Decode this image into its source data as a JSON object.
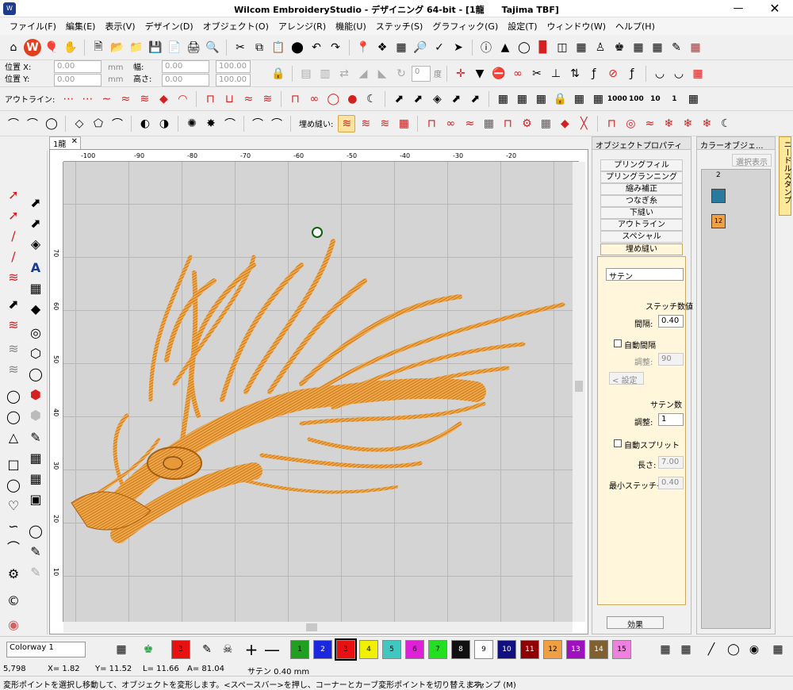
{
  "title": "Wilcom EmbroideryStudio - デザイニング 64-bit - [1龍　　Tajima TBF]",
  "menu": [
    "ファイル(F)",
    "編集(E)",
    "表示(V)",
    "デザイン(D)",
    "オブジェクト(O)",
    "アレンジ(R)",
    "機能(U)",
    "ステッチ(S)",
    "グラフィック(G)",
    "設定(T)",
    "ウィンドウ(W)",
    "ヘルプ(H)"
  ],
  "position": {
    "x_label": "位置 X:",
    "y_label": "位置 Y:",
    "x_val": "0.00",
    "y_val": "0.00",
    "unit": "mm"
  },
  "size": {
    "w_label": "幅:",
    "h_label": "高さ:",
    "w_val": "0.00",
    "h_val": "0.00",
    "w_pct": "100.00",
    "h_pct": "100.00",
    "unit": "mm",
    "pct": "%"
  },
  "rotate": {
    "value": "0",
    "unit": "度"
  },
  "outline_label": "アウトライン:",
  "fill_label": "埋め縫い:",
  "number_tools": [
    "1000",
    "100",
    "10",
    "1"
  ],
  "doc_tab": "1龍",
  "ruler_top": [
    "-100",
    "-90",
    "-80",
    "-70",
    "-60",
    "-50",
    "-40",
    "-30",
    "-20"
  ],
  "ruler_left": [
    "70",
    "60",
    "50",
    "40",
    "30",
    "20",
    "10"
  ],
  "props": {
    "title": "オブジェクトプロパティ",
    "tabs": [
      "プリングフィル",
      "プリングランニング",
      "縮み補正",
      "つなぎ糸",
      "下縫い",
      "アウトライン",
      "スペシャル",
      "埋め縫い"
    ],
    "stitch_type": "サテン",
    "stitch_value_label": "ステッチ数値",
    "spacing_label": "間隔:",
    "spacing_value": "0.40",
    "auto_spacing_label": "自動間隔",
    "adjust_label": "調整:",
    "adjust_value": "90",
    "set_label": "設定",
    "satin_count_label": "サテン数",
    "adjust2_label": "調整:",
    "adjust2_value": "1",
    "auto_split_label": "自動スプリット",
    "length_label": "長さ:",
    "length_value": "7.00",
    "min_stitch_label": "最小ステッチ長:",
    "min_stitch_value": "0.40",
    "effect_button": "効果"
  },
  "color_panel": {
    "title": "カラーオブジェ...",
    "select_button": "選択表示",
    "item_label": "2",
    "item2_label": "12"
  },
  "side_tab": "ニードルスタンプ",
  "colorway": "Colorway 1",
  "palette": [
    {
      "n": "3",
      "c": "#e81010"
    },
    {
      "n": "1",
      "c": "#20a020"
    },
    {
      "n": "2",
      "c": "#1c28e0"
    },
    {
      "n": "3",
      "c": "#e81010"
    },
    {
      "n": "4",
      "c": "#f0f000"
    },
    {
      "n": "5",
      "c": "#40c8c0"
    },
    {
      "n": "6",
      "c": "#e020d8"
    },
    {
      "n": "7",
      "c": "#20e020"
    },
    {
      "n": "8",
      "c": "#101010"
    },
    {
      "n": "9",
      "c": "#ffffff"
    },
    {
      "n": "10",
      "c": "#101080"
    },
    {
      "n": "11",
      "c": "#900000"
    },
    {
      "n": "12",
      "c": "#f0a040"
    },
    {
      "n": "13",
      "c": "#a010c0"
    },
    {
      "n": "14",
      "c": "#806030"
    },
    {
      "n": "15",
      "c": "#f080e0"
    }
  ],
  "coords": {
    "count": "5,798",
    "x": "X=   1.82",
    "y": "Y=   11.52",
    "l": "L=   11.66",
    "a": "A=   81.04",
    "stitch": "サテン  0.40 mm"
  },
  "status": {
    "left": "変形ポイントを選択し移動して、オブジェクトを変形します。<スペースバー>を押し、コーナーとカーブ変形ポイントを切り替えます。",
    "right": "ジャンプ (M)"
  },
  "accent": "#f0a040"
}
